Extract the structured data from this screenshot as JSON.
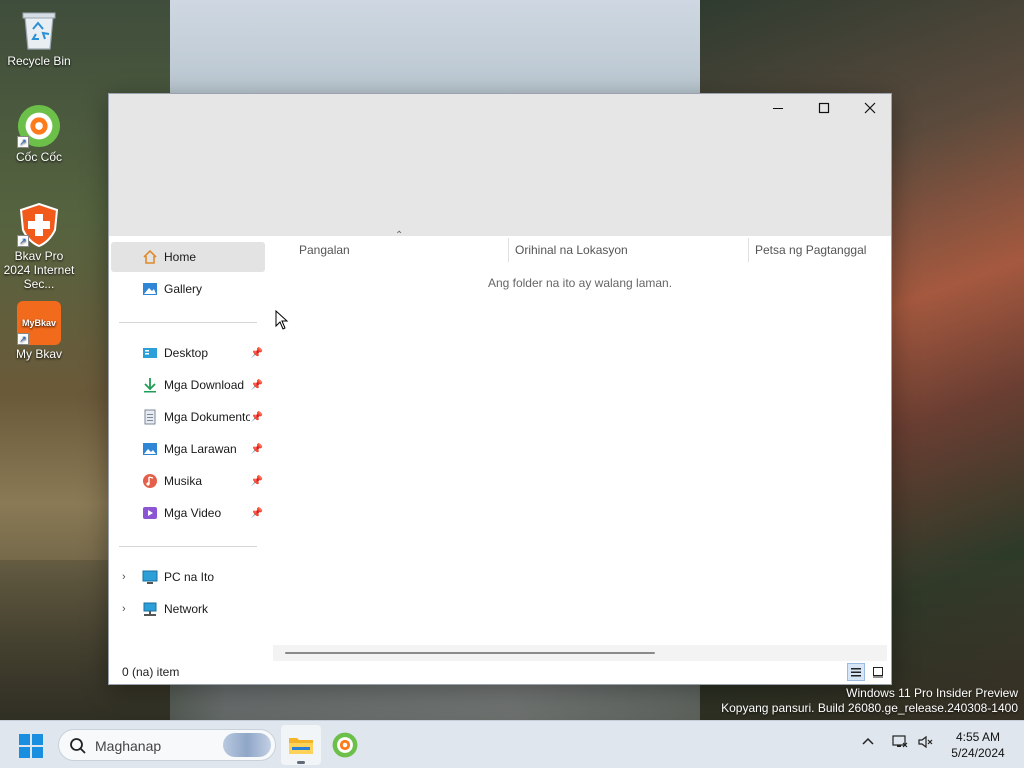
{
  "desktop": {
    "icons": [
      {
        "label": "Recycle Bin"
      },
      {
        "label": "Cốc Cốc"
      },
      {
        "label": "Bkav Pro 2024 Internet Sec..."
      },
      {
        "label": "My Bkav",
        "badge": "MyBkav"
      }
    ]
  },
  "window": {
    "controls": {
      "minimize": "—",
      "maximize": "☐",
      "close": "✕"
    },
    "nav": {
      "quick": [
        {
          "label": "Home",
          "icon": "home-icon",
          "selected": true
        },
        {
          "label": "Gallery",
          "icon": "gallery-icon"
        }
      ],
      "pinned": [
        {
          "label": "Desktop",
          "icon": "desktop-icon"
        },
        {
          "label": "Mga Download",
          "icon": "download-icon"
        },
        {
          "label": "Mga Dokumento",
          "icon": "documents-icon"
        },
        {
          "label": "Mga Larawan",
          "icon": "pictures-icon"
        },
        {
          "label": "Musika",
          "icon": "music-icon"
        },
        {
          "label": "Mga Video",
          "icon": "videos-icon"
        }
      ],
      "locations": [
        {
          "label": "PC na Ito",
          "icon": "pc-icon"
        },
        {
          "label": "Network",
          "icon": "network-icon"
        }
      ]
    },
    "columns": [
      "Pangalan",
      "Orihinal na Lokasyon",
      "Petsa ng Pagtanggal"
    ],
    "empty_message": "Ang folder na ito ay walang laman.",
    "status": "0 (na) item"
  },
  "watermark": {
    "line1": "Windows 11 Pro Insider Preview",
    "line2": "Kopyang pansuri. Build 26080.ge_release.240308-1400"
  },
  "taskbar": {
    "search_placeholder": "Maghanap",
    "time": "4:55 AM",
    "date": "5/24/2024"
  },
  "colors": {
    "accent": "#0067c0",
    "titlebar": "#e6e6e6",
    "taskbar": "#dfe6ee"
  }
}
